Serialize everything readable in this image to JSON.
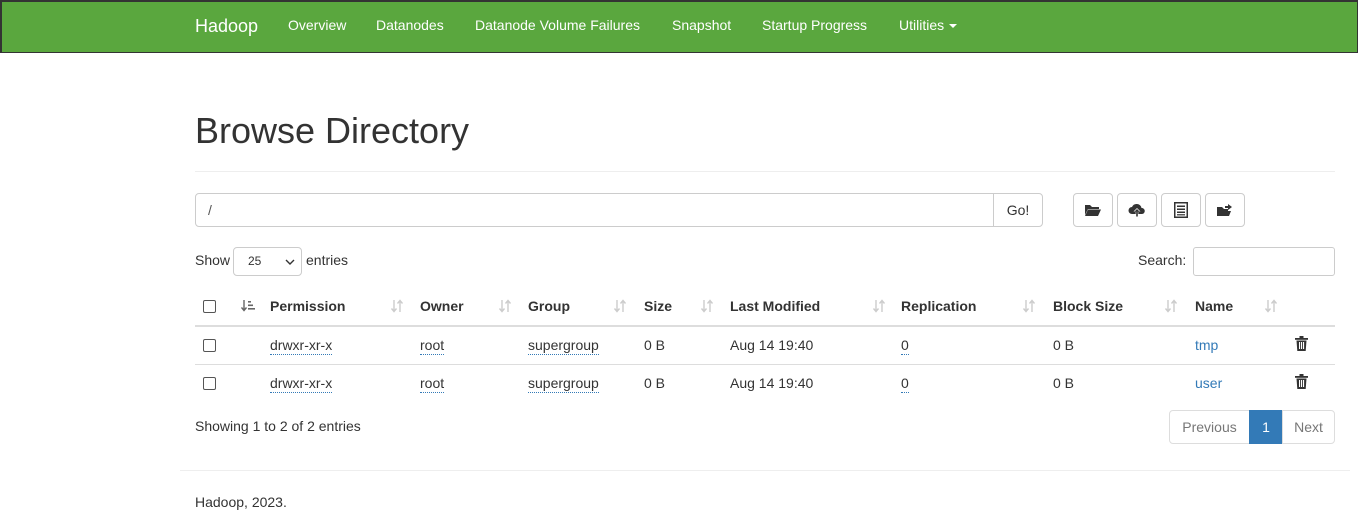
{
  "navbar": {
    "brand": "Hadoop",
    "items": [
      {
        "label": "Overview"
      },
      {
        "label": "Datanodes"
      },
      {
        "label": "Datanode Volume Failures"
      },
      {
        "label": "Snapshot"
      },
      {
        "label": "Startup Progress"
      },
      {
        "label": "Utilities"
      }
    ]
  },
  "page": {
    "title": "Browse Directory",
    "path_value": "/",
    "go_label": "Go!",
    "toolbar_icons": [
      "folder-open-icon",
      "cloud-upload-icon",
      "list-alt-icon",
      "folder-move-icon"
    ]
  },
  "table_controls": {
    "show_label": "Show",
    "page_length": "25",
    "entries_label": "entries",
    "search_label": "Search:"
  },
  "table": {
    "columns": [
      "Permission",
      "Owner",
      "Group",
      "Size",
      "Last Modified",
      "Replication",
      "Block Size",
      "Name"
    ],
    "rows": [
      {
        "permission": "drwxr-xr-x",
        "owner": "root",
        "group": "supergroup",
        "size": "0 B",
        "modified": "Aug 14 19:40",
        "replication": "0",
        "block_size": "0 B",
        "name": "tmp"
      },
      {
        "permission": "drwxr-xr-x",
        "owner": "root",
        "group": "supergroup",
        "size": "0 B",
        "modified": "Aug 14 19:40",
        "replication": "0",
        "block_size": "0 B",
        "name": "user"
      }
    ]
  },
  "pagination": {
    "info": "Showing 1 to 2 of 2 entries",
    "previous": "Previous",
    "current": "1",
    "next": "Next"
  },
  "footer": {
    "text": "Hadoop, 2023."
  },
  "colors": {
    "navbar_bg": "#5aa73e",
    "link": "#337ab7"
  }
}
